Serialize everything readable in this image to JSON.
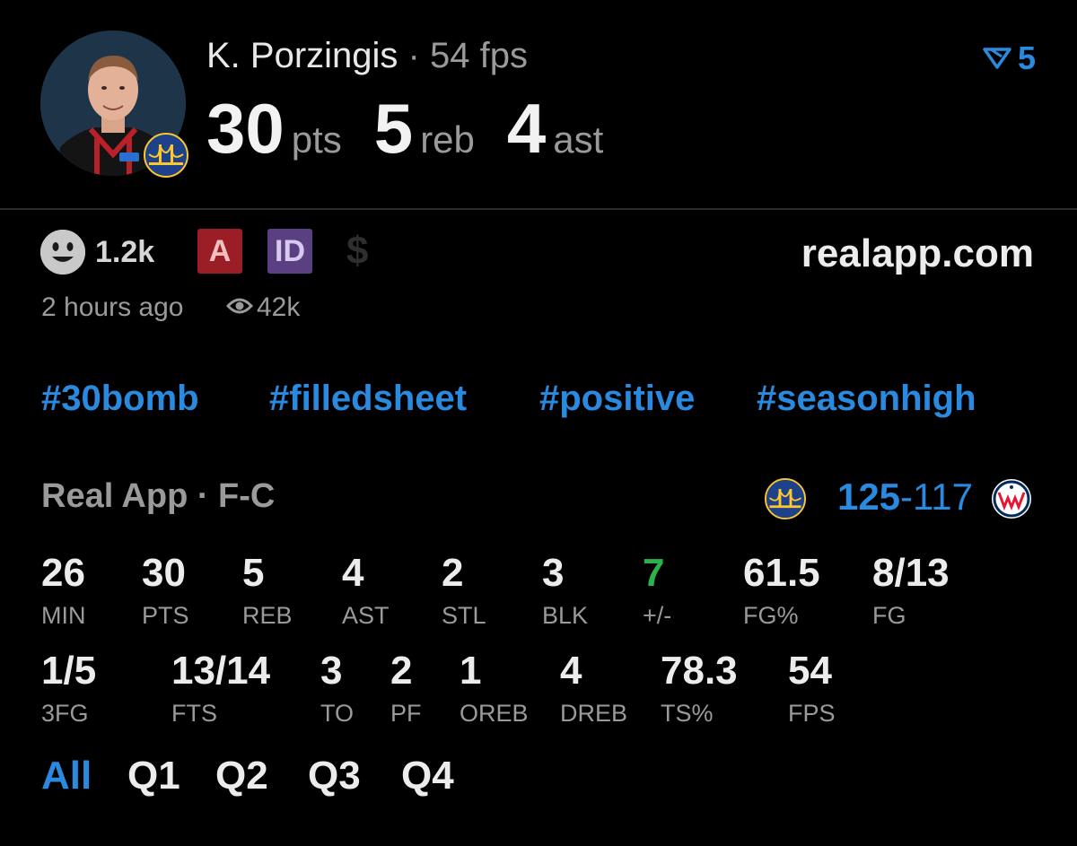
{
  "player": {
    "name": "K. Porzingis",
    "separator": "·",
    "fps": "54 fps",
    "pts": "30",
    "pts_unit": "pts",
    "reb": "5",
    "reb_unit": "reb",
    "ast": "4",
    "ast_unit": "ast"
  },
  "rank_badge": {
    "icon": "tiered-flag-icon",
    "value": "5"
  },
  "reactions": {
    "icon": "smiley-icon",
    "count": "1.2k",
    "badge_a": "A",
    "badge_id": "ID",
    "dollar": "$"
  },
  "site": "realapp.com",
  "meta": {
    "time": "2 hours ago",
    "views": "42k"
  },
  "hashtags": [
    "#30bomb",
    "#filledsheet",
    "#positive",
    "#seasonhigh"
  ],
  "game": {
    "source": "Real App · F-C",
    "home_score": "125",
    "away_score": "-117"
  },
  "stats_row1": [
    {
      "value": "26",
      "label": "MIN"
    },
    {
      "value": "30",
      "label": "PTS"
    },
    {
      "value": "5",
      "label": "REB"
    },
    {
      "value": "4",
      "label": "AST"
    },
    {
      "value": "2",
      "label": "STL"
    },
    {
      "value": "3",
      "label": "BLK"
    },
    {
      "value": "7",
      "label": "+/-"
    },
    {
      "value": "61.5",
      "label": "FG%"
    },
    {
      "value": "8/13",
      "label": "FG"
    }
  ],
  "stats_row2": [
    {
      "value": "1/5",
      "label": "3FG"
    },
    {
      "value": "13/14",
      "label": "FTS"
    },
    {
      "value": "3",
      "label": "TO"
    },
    {
      "value": "2",
      "label": "PF"
    },
    {
      "value": "1",
      "label": "OREB"
    },
    {
      "value": "4",
      "label": "DREB"
    },
    {
      "value": "78.3",
      "label": "TS%"
    },
    {
      "value": "54",
      "label": "FPS"
    }
  ],
  "quarter_tabs": [
    "All",
    "Q1",
    "Q2",
    "Q3",
    "Q4"
  ],
  "active_tab": "All",
  "colors": {
    "accent": "#2a8ae0",
    "positive": "#2bb34a",
    "badge_a": "#9b1d26",
    "badge_id": "#5b3f83"
  }
}
